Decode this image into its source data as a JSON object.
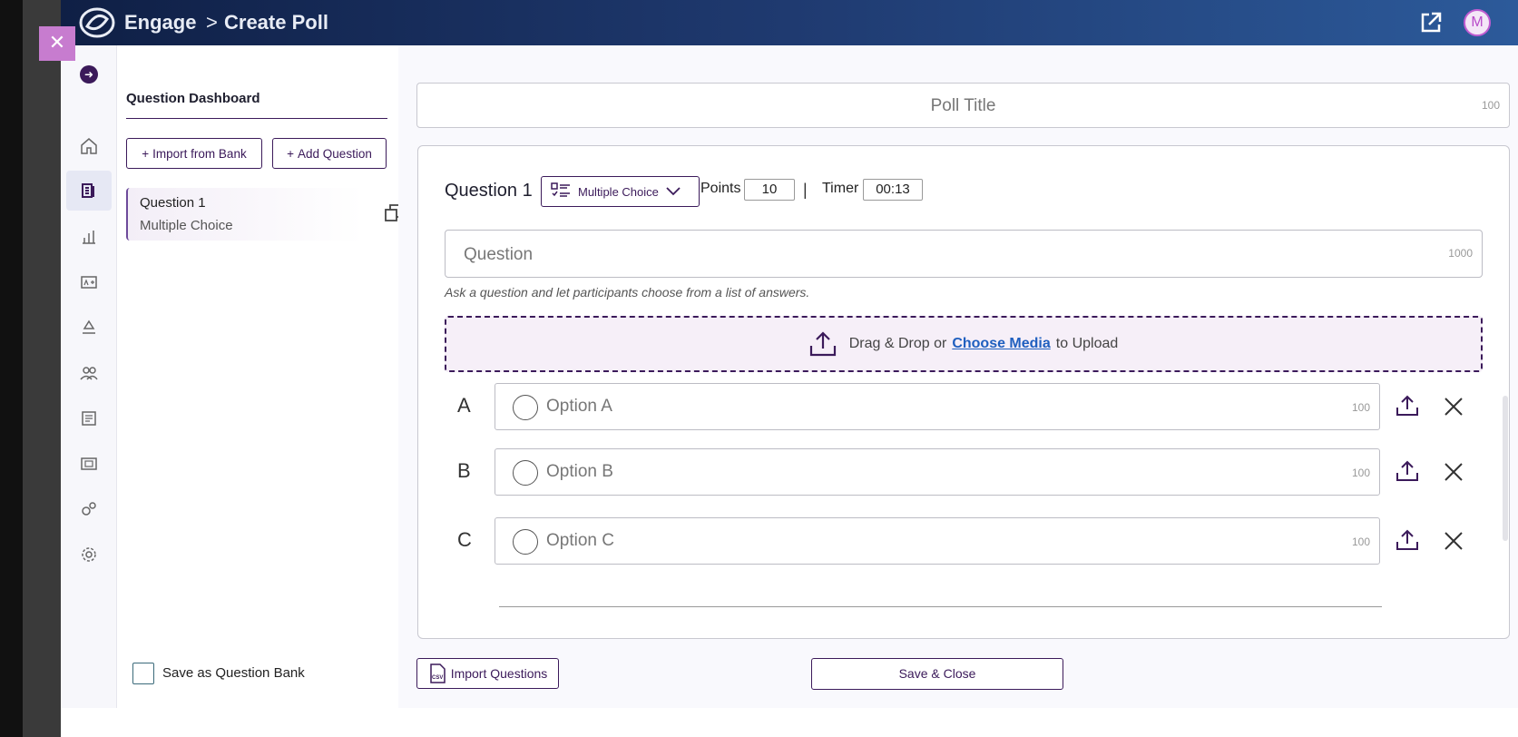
{
  "colors": {
    "primary": "#3b1a5a",
    "link": "#1f5fbf",
    "danger": "#c0244a",
    "close_button": "#c77ccf"
  },
  "header": {
    "app_name": "Engage",
    "separator": ">",
    "page_title": "Create Poll",
    "avatar_initial": "M"
  },
  "close_button": {
    "label": "✕"
  },
  "nav": {
    "expand_label": "➜",
    "items": [
      "home-icon",
      "polls-icon",
      "analytics-icon",
      "grades-icon",
      "recycle-icon",
      "groups-icon",
      "notes-icon",
      "gallery-icon",
      "integrations-icon",
      "settings-icon"
    ],
    "active_index": 1
  },
  "dashboard": {
    "title": "Question Dashboard",
    "import_bank_label": "Import from Bank",
    "add_question_label": "Add Question",
    "plus_glyph": "+",
    "question_card": {
      "title": "Question 1",
      "type": "Multiple Choice"
    },
    "save_bank_label": "Save as Question Bank"
  },
  "editor": {
    "poll_title_placeholder": "Poll Title",
    "poll_title_limit": "100",
    "question_label": "Question 1",
    "question_type": "Multiple Choice",
    "points_label": "Points",
    "points_value": "10",
    "pipe": "|",
    "timer_label": "Timer",
    "timer_value": "00:13",
    "question_placeholder": "Question",
    "question_limit": "1000",
    "hint": "Ask a question and let participants choose from a list of answers.",
    "upload": {
      "prefix": "Drag & Drop or",
      "link": "Choose Media",
      "suffix": "to Upload"
    },
    "options": [
      {
        "letter": "A",
        "placeholder": "Option A",
        "limit": "100"
      },
      {
        "letter": "B",
        "placeholder": "Option B",
        "limit": "100"
      },
      {
        "letter": "C",
        "placeholder": "Option C",
        "limit": "100"
      }
    ],
    "import_questions_label": "Import Questions",
    "save_close_label": "Save & Close"
  }
}
